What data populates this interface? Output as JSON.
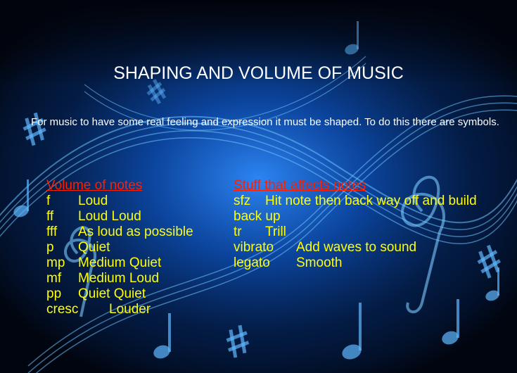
{
  "slide": {
    "title": "SHAPING AND VOLUME OF MUSIC",
    "intro": "For music to have some real feeling and expression it must be shaped. To do this there are symbols.",
    "volume_heading": "Volume of notes",
    "volume_rows": [
      {
        "symbol": "f",
        "meaning": "Loud"
      },
      {
        "symbol": "ff",
        "meaning": "Loud Loud"
      },
      {
        "symbol": "fff",
        "meaning": "As loud as possible"
      },
      {
        "symbol": "p",
        "meaning": "Quiet"
      },
      {
        "symbol": "mp",
        "meaning": "Medium Quiet"
      },
      {
        "symbol": "mf",
        "meaning": "Medium Loud"
      },
      {
        "symbol": "pp",
        "meaning": "Quiet Quiet"
      },
      {
        "symbol": "cresc",
        "meaning": "Louder"
      }
    ],
    "effects_heading": "Stuff that affects notes",
    "effects_rows": [
      {
        "symbol": "sfz",
        "meaning": "Hit note then back way off and build"
      },
      {
        "symbol": "",
        "meaning": "back up"
      },
      {
        "symbol": "tr",
        "meaning": "Trill"
      },
      {
        "symbol": "vibrato",
        "meaning": "Add waves to sound"
      },
      {
        "symbol": "legato",
        "meaning": "Smooth"
      }
    ]
  },
  "colors": {
    "background": "#020814",
    "glow": "#1e7dff",
    "title_text": "#ffffff",
    "heading_text": "#ff1e00",
    "body_text": "#ffff00"
  },
  "icons": [
    "music-notes-background",
    "sharp-sign-icon",
    "treble-clef-icon",
    "eighth-note-icon"
  ]
}
